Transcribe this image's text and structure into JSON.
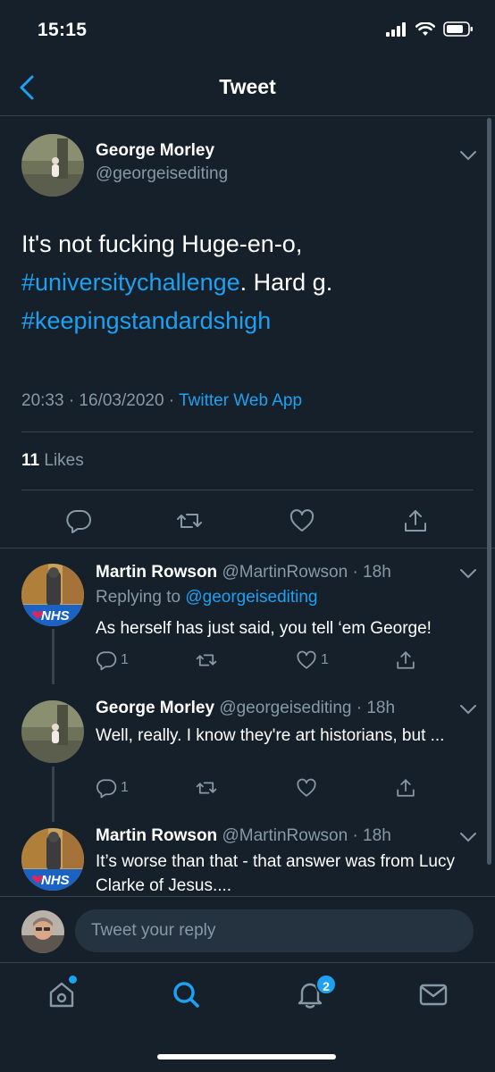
{
  "status": {
    "time": "15:15"
  },
  "nav": {
    "title": "Tweet"
  },
  "main_tweet": {
    "name": "George Morley",
    "handle": "@georgeisediting",
    "text_plain_1": "It's not fucking Huge-en-o,",
    "hashtag_1": "#universitychallenge",
    "text_plain_2": ".  Hard g.",
    "hashtag_2": "#keepingstandardshigh",
    "time": "20:33 · 16/03/2020 · ",
    "source": "Twitter Web App",
    "likes_count": "11",
    "likes_label": " Likes"
  },
  "replies": [
    {
      "name": "Martin Rowson",
      "handle": " @MartinRowson · 18h",
      "replying_label": "Replying to ",
      "replying_to": "@georgeisediting",
      "text": "As herself has just said, you tell ‘em George!",
      "reply_count": "1",
      "like_count": "1"
    },
    {
      "name": "George Morley",
      "handle": " @georgeisediting · 18h",
      "text": "Well, really.  I know they're art historians, but ...",
      "reply_count": "1"
    },
    {
      "name": "Martin Rowson",
      "handle": " @MartinRowson · 18h",
      "text": "It’s worse than that - that answer was from Lucy Clarke of Jesus...."
    }
  ],
  "composer": {
    "placeholder": "Tweet your reply"
  },
  "tabs": {
    "notifications_badge": "2"
  },
  "avatar_sign_text": "NHS",
  "colors": {
    "background": "#15202b",
    "accent": "#1da1f2",
    "secondary_text": "#8899a6",
    "divider": "#38444d"
  },
  "icons": [
    "back-arrow-icon",
    "signal-icon",
    "wifi-icon",
    "battery-icon",
    "chevron-down-icon",
    "reply-icon",
    "retweet-icon",
    "like-icon",
    "share-icon",
    "home-icon",
    "search-icon",
    "notifications-icon",
    "messages-icon"
  ]
}
